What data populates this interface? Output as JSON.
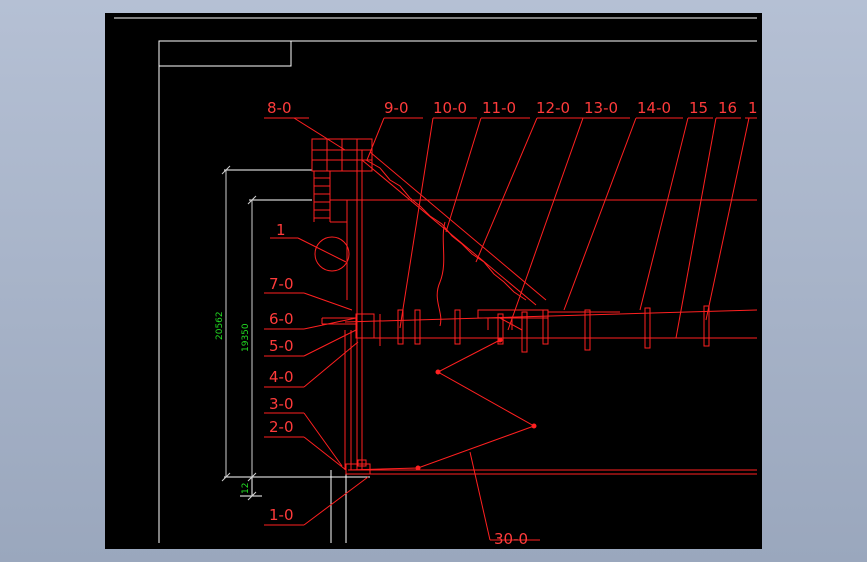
{
  "labels": {
    "l8": "8-0",
    "l9": "9-0",
    "l10": "10-0",
    "l11": "11-0",
    "l12": "12-0",
    "l13": "13-0",
    "l14": "14-0",
    "l15": "15",
    "l16": "16",
    "l17": "1",
    "l1": "1",
    "l7": "7-0",
    "l6": "6-0",
    "l5": "5-0",
    "l4": "4-0",
    "l3": "3-0",
    "l2": "2-0",
    "l10b": "1-0",
    "l30": "30-0"
  },
  "dimensions": {
    "d1": "20562",
    "d2": "19350",
    "d3": "12"
  },
  "colors": {
    "line": "#ff2020",
    "text": "#ff3b3b",
    "frame": "#ffffff",
    "dim": "#22dd22"
  }
}
